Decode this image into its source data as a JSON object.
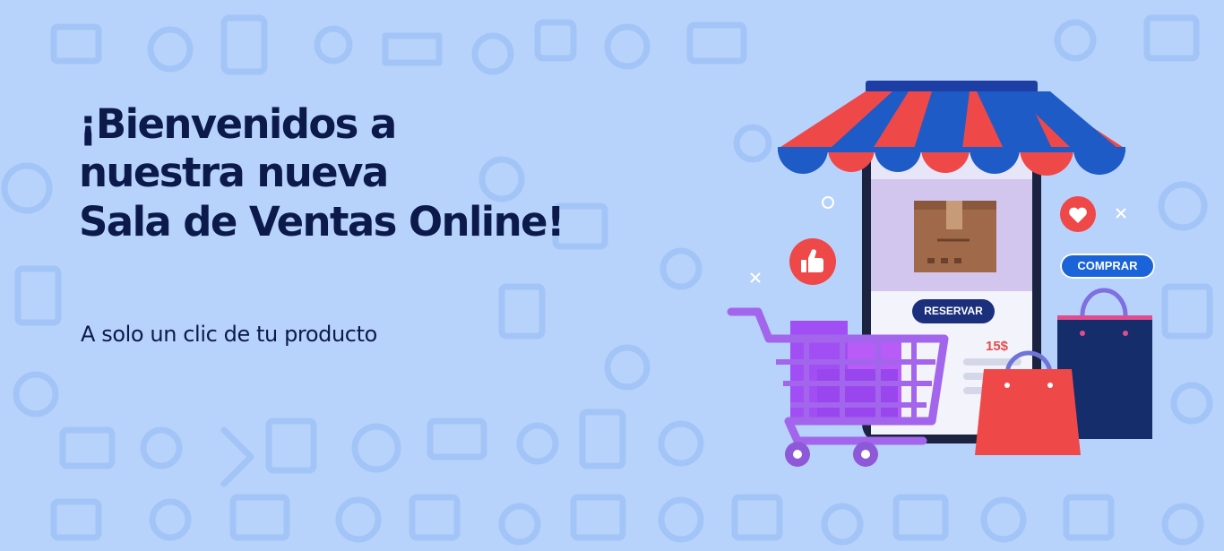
{
  "banner": {
    "headline_line1": "¡Bienvenidos a",
    "headline_line2": "nuestra nueva",
    "headline_line3": "Sala de Ventas Online!",
    "subtitle": "A solo un clic de tu producto"
  },
  "illustration": {
    "reserve_button": "RESERVAR",
    "buy_button": "COMPRAR",
    "price": "15$"
  },
  "colors": {
    "background": "#b7d3fb",
    "heading": "#0c1a4b",
    "awning_red": "#ef4848",
    "awning_blue": "#1e5bc6",
    "cart_purple": "#9b4ff0",
    "bag_navy": "#152d6b"
  }
}
